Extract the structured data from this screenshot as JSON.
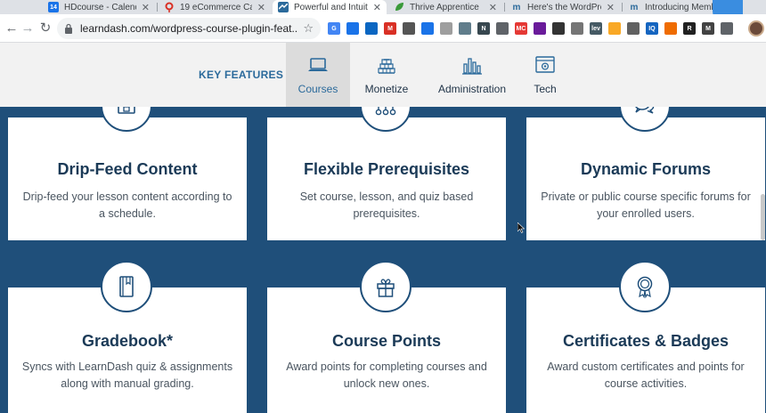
{
  "browser": {
    "tabs": [
      {
        "title": "HDcourse - Calend",
        "favicon": "calendar-icon",
        "favicon_text": "14",
        "color": "#1a73e8",
        "active": false
      },
      {
        "title": "19 eCommerce Ca",
        "favicon": "pin-icon",
        "favicon_text": "",
        "color": "#d93025",
        "active": false
      },
      {
        "title": "Powerful and Intuit",
        "favicon": "learndash-icon",
        "favicon_text": "",
        "color": "#2b6a9b",
        "active": true
      },
      {
        "title": "Thrive Apprentice",
        "favicon": "leaf-icon",
        "favicon_text": "",
        "color": "#3a9a3a",
        "active": false
      },
      {
        "title": "Here's the WordPre",
        "favicon": "m-icon",
        "favicon_text": "m",
        "color": "#2b6a9b",
        "active": false
      },
      {
        "title": "Introducing Membe",
        "favicon": "m-icon",
        "favicon_text": "m",
        "color": "#2b6a9b",
        "active": false
      }
    ],
    "url": "learndash.com/wordpress-course-plugin-feat...",
    "extensions": [
      {
        "name": "translate-icon",
        "text": "G",
        "color": "#4285f4"
      },
      {
        "name": "docs-badge-icon",
        "text": "",
        "color": "#1a73e8"
      },
      {
        "name": "outlook-icon",
        "text": "",
        "color": "#0a66c2"
      },
      {
        "name": "gmail-icon",
        "text": "M",
        "color": "#d93025"
      },
      {
        "name": "clipboard-icon",
        "text": "",
        "color": "#555555"
      },
      {
        "name": "calendar-badge-icon",
        "text": "",
        "color": "#1a73e8"
      },
      {
        "name": "circle-icon",
        "text": "",
        "color": "#9e9e9e"
      },
      {
        "name": "globe-icon",
        "text": "",
        "color": "#607d8b"
      },
      {
        "name": "notion-icon",
        "text": "N",
        "color": "#37474f"
      },
      {
        "name": "monitor-icon",
        "text": "",
        "color": "#5f6368"
      },
      {
        "name": "mc-icon",
        "text": "MC",
        "color": "#e53935"
      },
      {
        "name": "badge-icon",
        "text": "",
        "color": "#6a1b9a"
      },
      {
        "name": "sheet-icon",
        "text": "",
        "color": "#333333"
      },
      {
        "name": "camera-icon",
        "text": "",
        "color": "#757575"
      },
      {
        "name": "lev-icon",
        "text": "lev",
        "color": "#455a64"
      },
      {
        "name": "honey-icon",
        "text": "",
        "color": "#f9a825"
      },
      {
        "name": "frame-icon",
        "text": "",
        "color": "#616161"
      },
      {
        "name": "iq-icon",
        "text": "IQ",
        "color": "#1565c0"
      },
      {
        "name": "tag-icon",
        "text": "",
        "color": "#ef6c00"
      },
      {
        "name": "r-icon",
        "text": "R",
        "color": "#212121"
      },
      {
        "name": "m-ext-icon",
        "text": "M",
        "color": "#424242"
      },
      {
        "name": "puzzle-icon",
        "text": "",
        "color": "#5f6368"
      }
    ]
  },
  "feature_nav": {
    "label": "KEY FEATURES",
    "tabs": [
      {
        "label": "Courses",
        "icon": "laptop-icon",
        "active": true
      },
      {
        "label": "Monetize",
        "icon": "bricks-icon",
        "active": false
      },
      {
        "label": "Administration",
        "icon": "bar-chart-icon",
        "active": false
      },
      {
        "label": "Tech",
        "icon": "settings-window-icon",
        "active": false
      }
    ]
  },
  "features": [
    {
      "title": "Drip-Feed Content",
      "desc": "Drip-feed your lesson content according to a schedule.",
      "icon": "lock-calendar-icon"
    },
    {
      "title": "Flexible Prerequisites",
      "desc": "Set course, lesson, and quiz based prerequisites.",
      "icon": "hierarchy-icon"
    },
    {
      "title": "Dynamic Forums",
      "desc": "Private or public course specific forums for your enrolled users.",
      "icon": "chat-bubbles-icon"
    },
    {
      "title": "Gradebook*",
      "desc": "Syncs with LearnDash quiz & assignments along with manual grading.",
      "icon": "notebook-icon"
    },
    {
      "title": "Course Points",
      "desc": "Award points for completing courses and unlock new ones.",
      "icon": "gift-icon"
    },
    {
      "title": "Certificates & Badges",
      "desc": "Award custom certificates and points for course activities.",
      "icon": "award-icon"
    }
  ],
  "colors": {
    "brand_blue": "#1f4f7a",
    "accent_blue": "#2b6a9b",
    "nav_bg": "#f2f2f2"
  }
}
